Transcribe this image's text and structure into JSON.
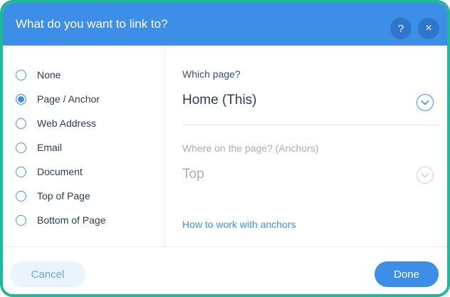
{
  "dialog": {
    "title": "What do you want to link to?",
    "help_glyph": "?",
    "close_glyph": "×"
  },
  "options": [
    {
      "label": "None",
      "selected": false
    },
    {
      "label": "Page / Anchor",
      "selected": true
    },
    {
      "label": "Web Address",
      "selected": false
    },
    {
      "label": "Email",
      "selected": false
    },
    {
      "label": "Document",
      "selected": false
    },
    {
      "label": "Top of Page",
      "selected": false
    },
    {
      "label": "Bottom of Page",
      "selected": false
    }
  ],
  "page_select": {
    "label": "Which page?",
    "value": "Home (This)"
  },
  "anchor_select": {
    "label": "Where on the page? (Anchors)",
    "value": "Top"
  },
  "help_link": "How to work with anchors",
  "footer": {
    "cancel_label": "Cancel",
    "done_label": "Done"
  },
  "colors": {
    "accent": "#3d8ee6",
    "frame": "#1fb89a",
    "text": "#2b3d55",
    "muted": "#a7adb6"
  },
  "icons": {
    "help": "help-icon",
    "close": "close-icon",
    "dropdown": "chevron-down-icon"
  }
}
